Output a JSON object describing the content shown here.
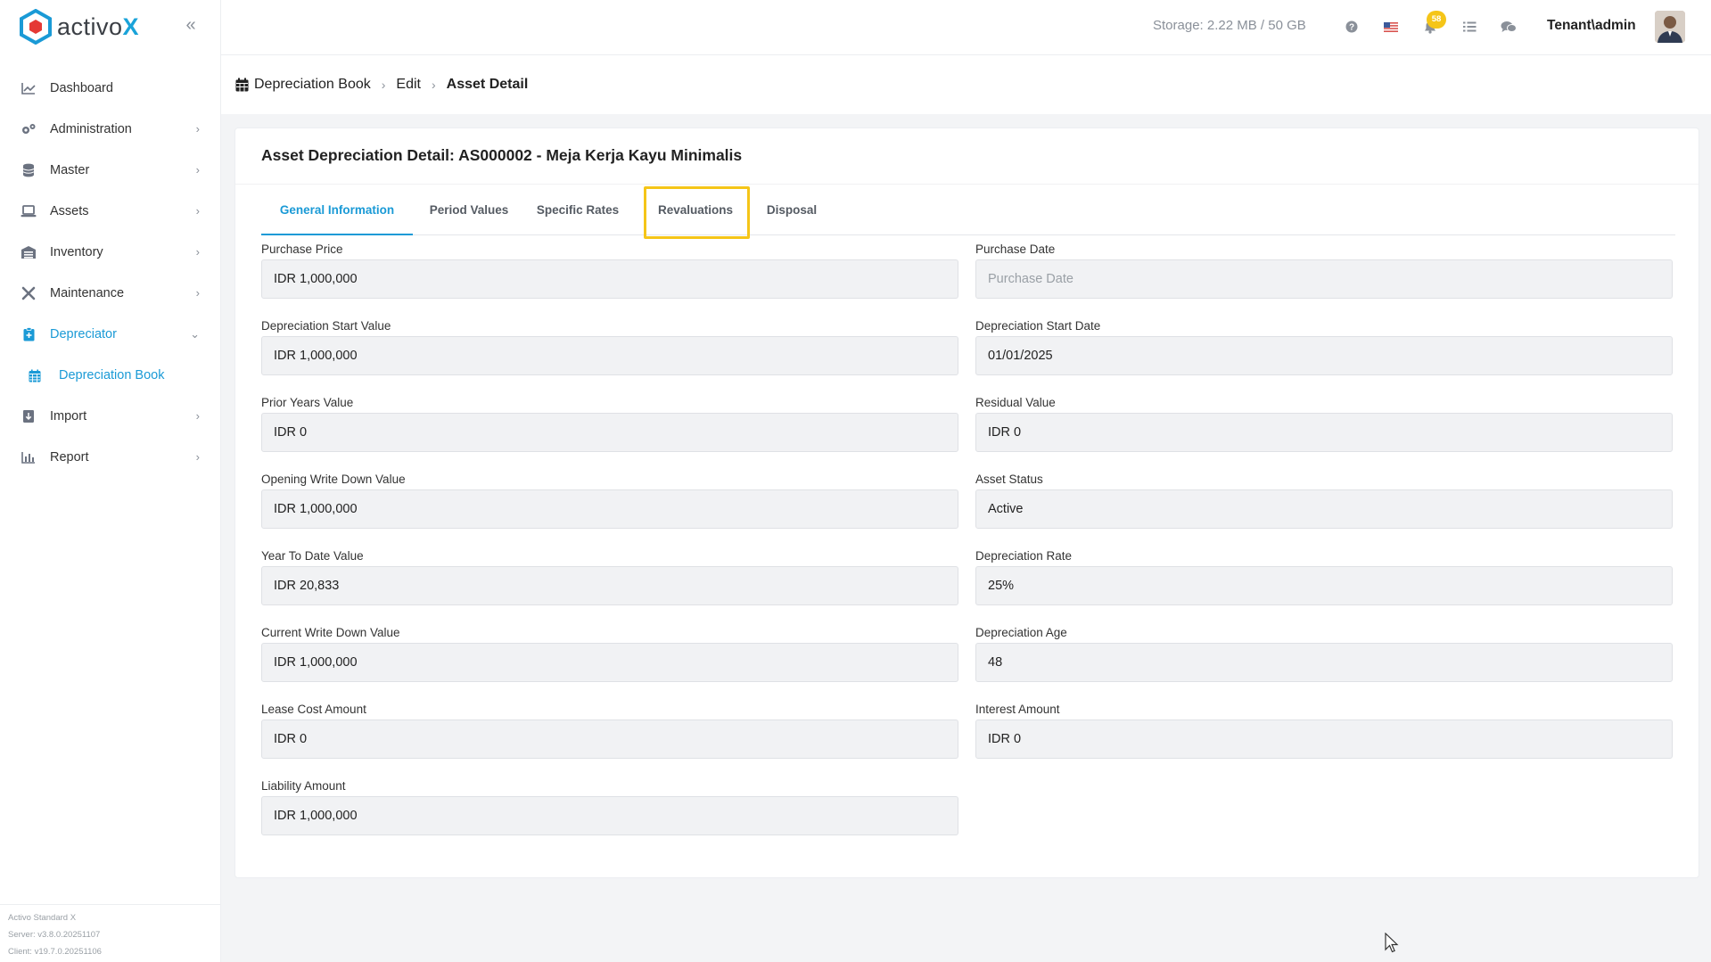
{
  "app": {
    "logo_text": "activo",
    "logo_accent": "X",
    "version_lines": [
      "Activo Standard X",
      "Server: v3.8.0.20251107",
      "Client: v19.7.0.20251106"
    ]
  },
  "sidebar": {
    "items": [
      {
        "label": "Dashboard",
        "icon": "chart-line-icon",
        "has_children": false
      },
      {
        "label": "Administration",
        "icon": "cogs-icon",
        "has_children": true
      },
      {
        "label": "Master",
        "icon": "database-icon",
        "has_children": true
      },
      {
        "label": "Assets",
        "icon": "laptop-icon",
        "has_children": true
      },
      {
        "label": "Inventory",
        "icon": "warehouse-icon",
        "has_children": true
      },
      {
        "label": "Maintenance",
        "icon": "tools-icon",
        "has_children": true
      },
      {
        "label": "Depreciator",
        "icon": "clipboard-icon",
        "has_children": true,
        "expanded": true
      },
      {
        "label": "Import",
        "icon": "import-icon",
        "has_children": true
      },
      {
        "label": "Report",
        "icon": "bar-chart-icon",
        "has_children": true
      }
    ],
    "sub_item": {
      "label": "Depreciation Book",
      "icon": "calendar-icon"
    }
  },
  "topbar": {
    "storage": "Storage: 2.22 MB / 50 GB",
    "notification_count": "58",
    "user": "Tenant\\admin"
  },
  "breadcrumb": {
    "items": [
      "Depreciation Book",
      "Edit",
      "Asset Detail"
    ]
  },
  "card": {
    "title": "Asset Depreciation Detail: AS000002 - Meja Kerja Kayu Minimalis",
    "tabs": [
      "General Information",
      "Period Values",
      "Specific Rates",
      "Revaluations",
      "Disposal"
    ],
    "active_tab": "General Information",
    "highlighted_tab": "Revaluations"
  },
  "fields": {
    "left": [
      {
        "label": "Purchase Price",
        "value": "IDR 1,000,000"
      },
      {
        "label": "Depreciation Start Value",
        "value": "IDR 1,000,000"
      },
      {
        "label": "Prior Years Value",
        "value": "IDR 0"
      },
      {
        "label": "Opening Write Down Value",
        "value": "IDR 1,000,000"
      },
      {
        "label": "Year To Date Value",
        "value": "IDR 20,833"
      },
      {
        "label": "Current Write Down Value",
        "value": "IDR 1,000,000"
      },
      {
        "label": "Lease Cost Amount",
        "value": "IDR 0"
      },
      {
        "label": "Liability Amount",
        "value": "IDR 1,000,000"
      }
    ],
    "right": [
      {
        "label": "Purchase Date",
        "value": "",
        "placeholder": "Purchase Date"
      },
      {
        "label": "Depreciation Start Date",
        "value": "01/01/2025"
      },
      {
        "label": "Residual Value",
        "value": "IDR 0"
      },
      {
        "label": "Asset Status",
        "value": "Active"
      },
      {
        "label": "Depreciation Rate",
        "value": "25%"
      },
      {
        "label": "Depreciation Age",
        "value": "48"
      },
      {
        "label": "Interest Amount",
        "value": "IDR 0"
      }
    ]
  },
  "colors": {
    "accent": "#1a9ad6",
    "highlight": "#f5c518",
    "badge": "#f5c518"
  }
}
